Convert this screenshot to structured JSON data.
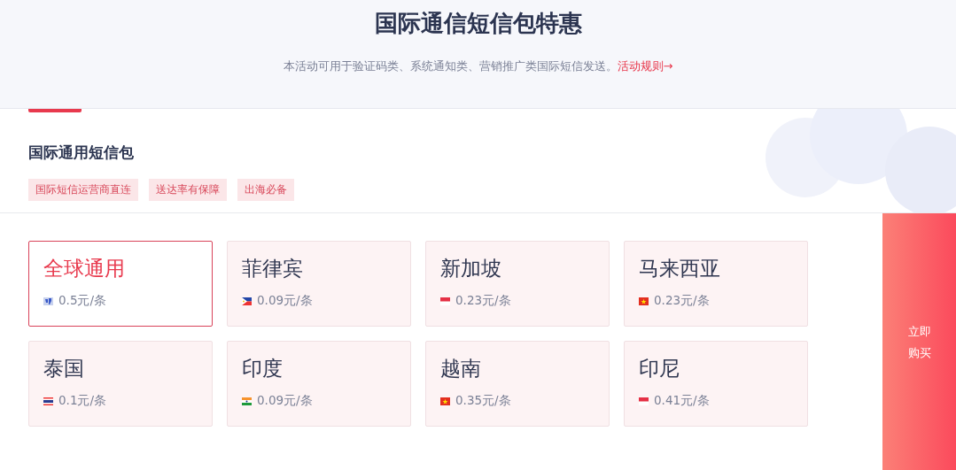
{
  "header": {
    "title": "国际通信短信包特惠",
    "subtitle": "本活动可用于验证码类、系统通知类、营销推广类国际短信发送。",
    "rules_link": "活动规则→"
  },
  "package": {
    "title": "国际通用短信包",
    "tags": [
      "国际短信运营商直连",
      "送达率有保障",
      "出海必备"
    ]
  },
  "options": [
    {
      "name": "全球通用",
      "price": "0.5元/条",
      "kind": "globe",
      "selected": true
    },
    {
      "name": "菲律宾",
      "price": "0.09元/条",
      "kind": "triangle",
      "selected": false
    },
    {
      "name": "新加坡",
      "price": "0.23元/条",
      "kind": "redwhite",
      "selected": false
    },
    {
      "name": "马来西亚",
      "price": "0.23元/条",
      "kind": "star",
      "selected": false
    },
    {
      "name": "泰国",
      "price": "0.1元/条",
      "kind": "stripes",
      "selected": false
    },
    {
      "name": "印度",
      "price": "0.09元/条",
      "kind": "tricolor",
      "selected": false
    },
    {
      "name": "越南",
      "price": "0.35元/条",
      "kind": "star",
      "selected": false
    },
    {
      "name": "印尼",
      "price": "0.41元/条",
      "kind": "redwhite",
      "selected": false
    }
  ],
  "buy_button": {
    "label": "立即购买"
  }
}
